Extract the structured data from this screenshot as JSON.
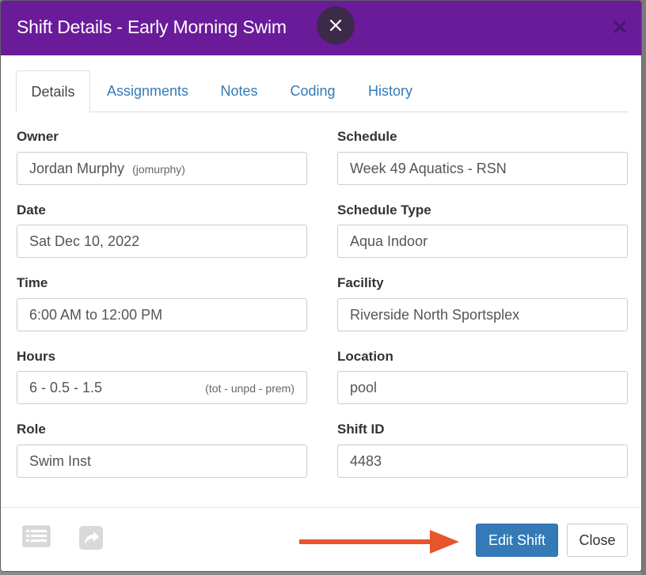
{
  "modal": {
    "title": "Shift Details - Early Morning Swim"
  },
  "tabs": [
    {
      "label": "Details",
      "active": true
    },
    {
      "label": "Assignments",
      "active": false
    },
    {
      "label": "Notes",
      "active": false
    },
    {
      "label": "Coding",
      "active": false
    },
    {
      "label": "History",
      "active": false
    }
  ],
  "fields": {
    "owner": {
      "label": "Owner",
      "value": "Jordan Murphy",
      "sub": "(jomurphy)"
    },
    "schedule": {
      "label": "Schedule",
      "value": "Week 49 Aquatics - RSN"
    },
    "date": {
      "label": "Date",
      "value": "Sat Dec 10, 2022"
    },
    "schedule_type": {
      "label": "Schedule Type",
      "value": "Aqua Indoor"
    },
    "time": {
      "label": "Time",
      "value": "6:00 AM to 12:00 PM"
    },
    "facility": {
      "label": "Facility",
      "value": "Riverside North Sportsplex"
    },
    "hours": {
      "label": "Hours",
      "value": "6 - 0.5 - 1.5",
      "note": "(tot - unpd - prem)"
    },
    "location": {
      "label": "Location",
      "value": "pool"
    },
    "role": {
      "label": "Role",
      "value": "Swim Inst"
    },
    "shift_id": {
      "label": "Shift ID",
      "value": "4483"
    }
  },
  "footer": {
    "edit_label": "Edit Shift",
    "close_label": "Close",
    "icons": [
      "list-icon",
      "share-icon"
    ]
  },
  "colors": {
    "header": "#6a1b9a",
    "primary": "#337ab7",
    "arrow": "#e8542b"
  }
}
